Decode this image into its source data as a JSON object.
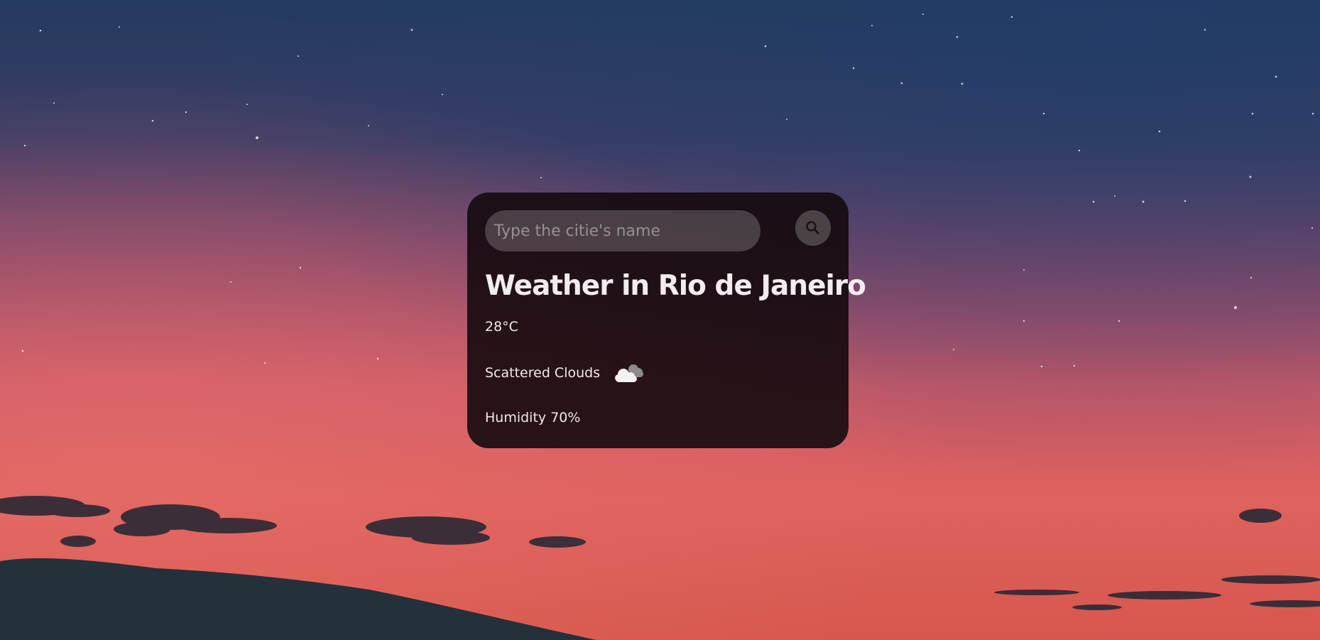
{
  "search": {
    "placeholder": "Type the citie's name",
    "value": ""
  },
  "weather": {
    "title": "Weather in Rio de Janeiro",
    "temperature": "28°C",
    "description": "Scattered Clouds",
    "icon": "scattered-clouds-icon",
    "humidity": "Humidity 70%"
  },
  "colors": {
    "card_background": "#140a0e",
    "text": "#f1e9ea",
    "sky_top": "#243a5e",
    "sky_bottom": "#e0645c"
  }
}
